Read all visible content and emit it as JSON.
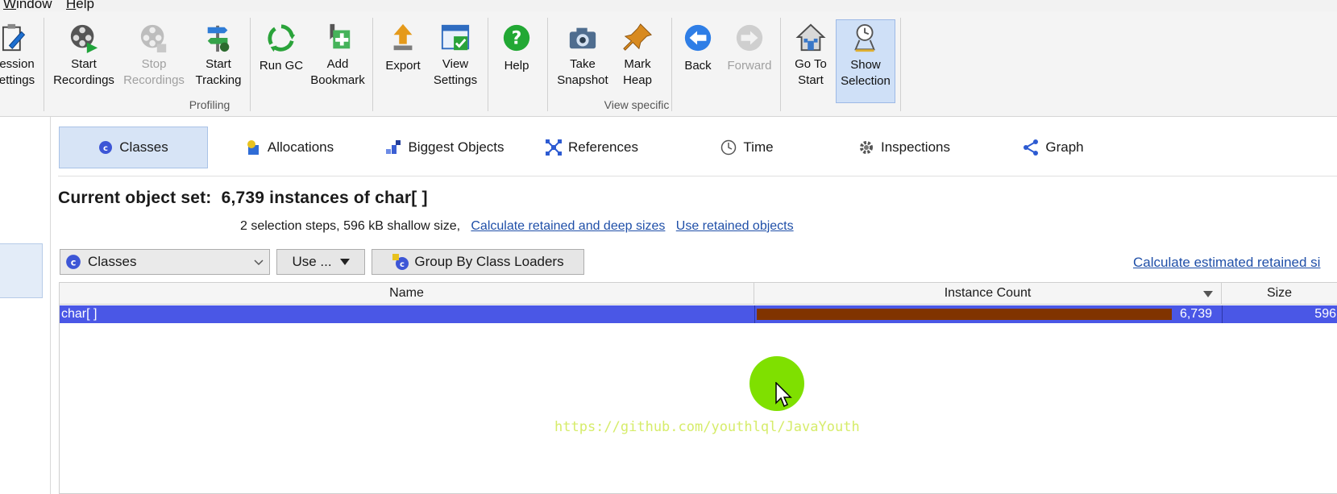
{
  "menu": {
    "window": "Window",
    "window_mnemonic": "W",
    "window_rest": "indow",
    "help_mnemonic": "H",
    "help_rest": "elp"
  },
  "toolbar": {
    "session_settings": {
      "line1": "ession",
      "line2": "ettings"
    },
    "start_recordings": {
      "line1": "Start",
      "line2": "Recordings"
    },
    "stop_recordings": {
      "line1": "Stop",
      "line2": "Recordings"
    },
    "start_tracking": {
      "line1": "Start",
      "line2": "Tracking"
    },
    "run_gc": {
      "line1": "Run GC"
    },
    "add_bookmark": {
      "line1": "Add",
      "line2": "Bookmark"
    },
    "export": {
      "line1": "Export"
    },
    "view_settings": {
      "line1": "View",
      "line2": "Settings"
    },
    "help": {
      "line1": "Help"
    },
    "take_snapshot": {
      "line1": "Take",
      "line2": "Snapshot"
    },
    "mark_heap": {
      "line1": "Mark",
      "line2": "Heap"
    },
    "back": {
      "line1": "Back"
    },
    "forward": {
      "line1": "Forward"
    },
    "go_to_start": {
      "line1": "Go To",
      "line2": "Start"
    },
    "show_selection": {
      "line1": "Show",
      "line2": "Selection"
    },
    "group_profiling": "Profiling",
    "group_view_specific": "View specific"
  },
  "tabs": [
    {
      "label": "Classes"
    },
    {
      "label": "Allocations"
    },
    {
      "label": "Biggest Objects"
    },
    {
      "label": "References"
    },
    {
      "label": "Time"
    },
    {
      "label": "Inspections"
    },
    {
      "label": "Graph"
    }
  ],
  "object_set": {
    "title_prefix": "Current object set:",
    "title_value": "6,739 instances of char[ ]",
    "summary": "2 selection steps, 596 kB shallow size,",
    "link_calculate": "Calculate retained and deep sizes",
    "link_use_retained": "Use retained objects"
  },
  "controls": {
    "view_select": "Classes",
    "use_menu": "Use ...",
    "group_by": "Group By Class Loaders",
    "estimated_link": "Calculate estimated retained si"
  },
  "table": {
    "columns": [
      "Name",
      "Instance Count",
      "Size"
    ],
    "rows": [
      {
        "name": "char[ ]",
        "count": "6,739",
        "count_fraction": 1.0,
        "size": "596"
      }
    ]
  },
  "watermark": "https://github.com/youthlql/JavaYouth",
  "colors": {
    "selection_row": "#4a57e6",
    "count_bar": "#803300",
    "accent": "#1f4fa8"
  }
}
